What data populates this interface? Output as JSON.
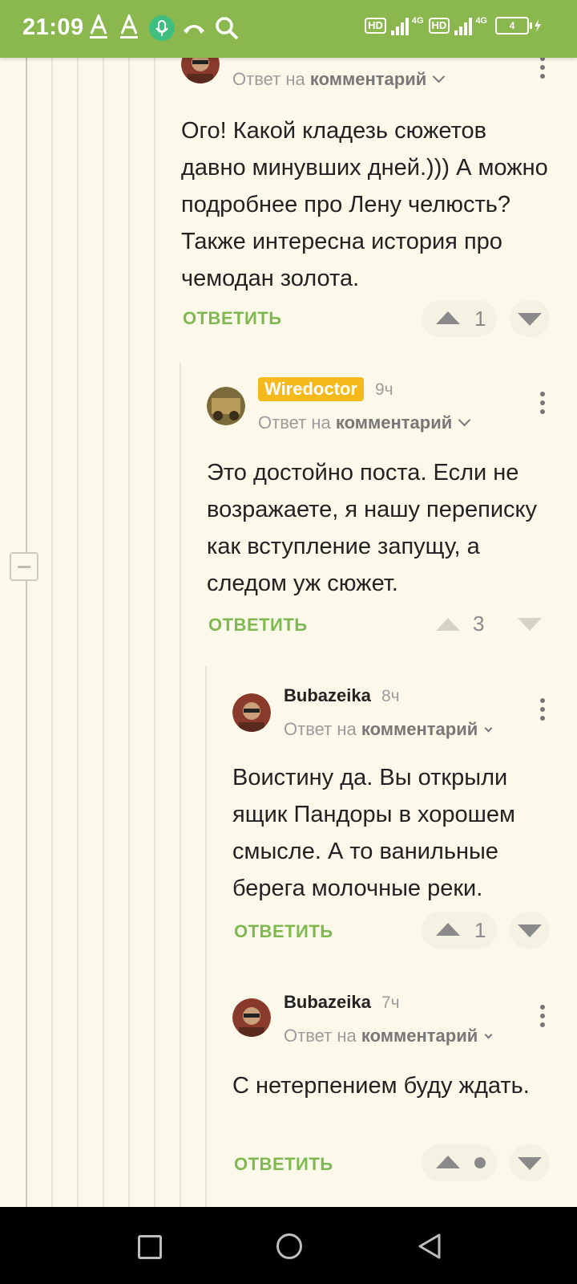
{
  "status_bar": {
    "time": "21:09",
    "hd1": "HD",
    "net1": "4G",
    "hd2": "HD",
    "net2": "4G",
    "battery": "4",
    "icons": [
      "font-a-icon",
      "font-a-icon",
      "mic-icon",
      "phone-icon",
      "search-icon",
      "signal-icon",
      "battery-icon",
      "charging-icon"
    ]
  },
  "comments": [
    {
      "reply_prefix": "Ответ на",
      "reply_target": "комментарий",
      "text": "Ого! Какой кладезь сюжетов давно минувших дней.))) А можно подробнее про Лену челюсть? Также интересна история про чемодан золота.",
      "reply_label": "ОТВЕТИТЬ",
      "votes": "1"
    },
    {
      "username": "Wiredoctor",
      "time": "9ч",
      "reply_prefix": "Ответ на",
      "reply_target": "комментарий",
      "text": "Это достойно поста. Если не возражаете, я нашу переписку как вступление запущу, а следом уж сюжет.",
      "reply_label": "ОТВЕТИТЬ",
      "votes": "3"
    },
    {
      "username": "Bubazeika",
      "time": "8ч",
      "reply_prefix": "Ответ на",
      "reply_target": "комментарий",
      "text": "Воистину да. Вы открыли ящик Пандоры в хорошем смысле. А то ванильные берега молочные реки.",
      "reply_label": "ОТВЕТИТЬ",
      "votes": "1"
    },
    {
      "username": "Bubazeika",
      "time": "7ч",
      "reply_prefix": "Ответ на",
      "reply_target": "комментарий",
      "text": "С нетерпением буду ждать.",
      "reply_label": "ОТВЕТИТЬ",
      "votes": ""
    }
  ],
  "colors": {
    "accent": "#8ab84f",
    "reply": "#7fb850",
    "badge": "#f4b91b",
    "background": "#fdf9ea"
  }
}
